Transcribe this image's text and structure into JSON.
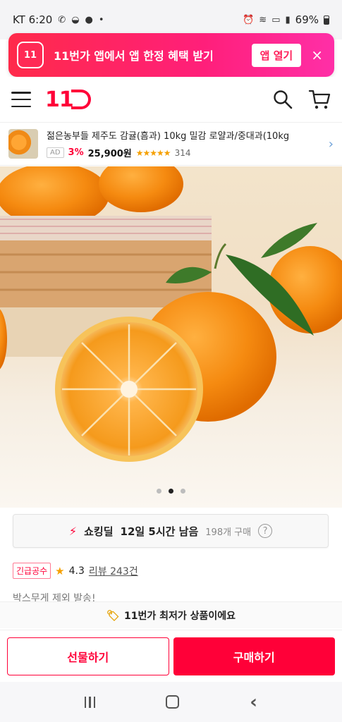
{
  "status_bar": {
    "carrier_time": "KT 6:20",
    "battery_pct": "69%"
  },
  "app_banner": {
    "logo_text": "11",
    "message": "11번가 앱에서 앱 한정 혜택 받기",
    "open_label": "앱 열기",
    "close_symbol": "×"
  },
  "header": {
    "logo_text": "11"
  },
  "ad": {
    "title": "젊은농부들 제주도 감귤(흠과) 10kg 밀감 로얄과/중대과(10kg",
    "badge": "AD",
    "discount": "3%",
    "price": "25,900원",
    "rating_stars": 4.5,
    "stars_text": "★★★★★",
    "review_count": "314"
  },
  "hero": {
    "image_count": 3,
    "active_index": 1
  },
  "deal": {
    "label": "쇼킹딜",
    "time_left": "12일 5시간 남음",
    "sold": "198개 구매",
    "help_symbol": "?"
  },
  "rating": {
    "badge": "긴급공수",
    "star": "★",
    "value": "4.3",
    "reviews_link": "리뷰 243건"
  },
  "description": "박스무게 제외 발송!",
  "lowest_banner": "11번가 최저가 상품이에요",
  "actions": {
    "gift_label": "선물하기",
    "buy_label": "구매하기"
  },
  "colors": {
    "brand": "#ff0038",
    "star": "#f5a000"
  }
}
